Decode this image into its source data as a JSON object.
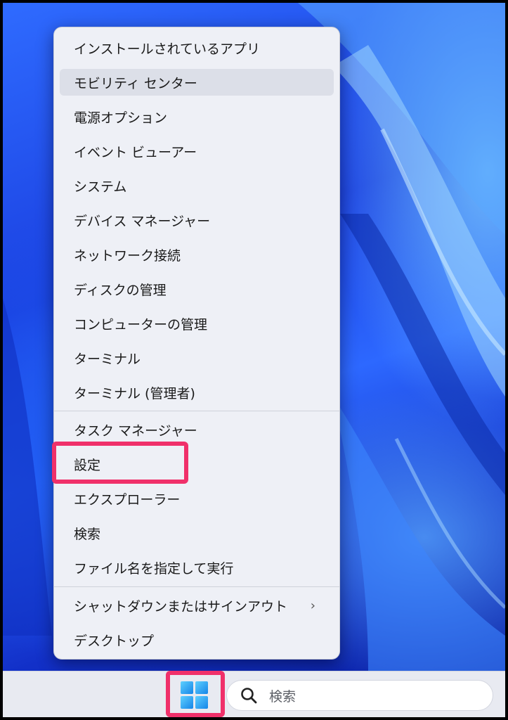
{
  "menu": {
    "items": [
      {
        "label": "インストールされているアプリ"
      },
      {
        "label": "モビリティ センター"
      },
      {
        "label": "電源オプション"
      },
      {
        "label": "イベント ビューアー"
      },
      {
        "label": "システム"
      },
      {
        "label": "デバイス マネージャー"
      },
      {
        "label": "ネットワーク接続"
      },
      {
        "label": "ディスクの管理"
      },
      {
        "label": "コンピューターの管理"
      },
      {
        "label": "ターミナル"
      },
      {
        "label": "ターミナル (管理者)"
      },
      {
        "label": "タスク マネージャー"
      },
      {
        "label": "設定"
      },
      {
        "label": "エクスプローラー"
      },
      {
        "label": "検索"
      },
      {
        "label": "ファイル名を指定して実行"
      },
      {
        "label": "シャットダウンまたはサインアウト",
        "submenu_glyph": "›"
      },
      {
        "label": "デスクトップ"
      }
    ]
  },
  "taskbar": {
    "start_icon": "windows-logo-icon",
    "search": {
      "placeholder": "検索",
      "icon": "search-icon"
    }
  },
  "colors": {
    "highlight": "#f0306a",
    "menu_bg": "#eef0f6",
    "taskbar_bg": "#e8eaf1",
    "wallpaper_blue": "#1a3fe0"
  }
}
